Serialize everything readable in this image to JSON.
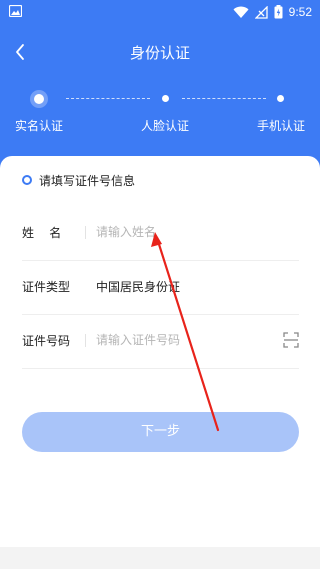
{
  "status_bar": {
    "time": "9:52",
    "icons": [
      "image-icon",
      "wifi-icon",
      "signal-off-icon",
      "battery-charging-icon"
    ]
  },
  "header": {
    "title": "身份认证",
    "back_icon": "chevron-left-icon"
  },
  "stepper": {
    "steps": [
      {
        "label": "实名认证",
        "state": "active"
      },
      {
        "label": "人脸认证",
        "state": "pending"
      },
      {
        "label": "手机认证",
        "state": "pending"
      }
    ]
  },
  "form": {
    "section_title": "请填写证件号信息",
    "name": {
      "label": "姓    名",
      "placeholder": "请输入姓名",
      "value": ""
    },
    "id_type": {
      "label": "证件类型",
      "value": "中国居民身份证"
    },
    "id_number": {
      "label": "证件号码",
      "placeholder": "请输入证件号码",
      "value": "",
      "scan_icon": "scan-icon"
    },
    "next_label": "下一步"
  },
  "colors": {
    "primary": "#3d7bf4",
    "button_disabled": "#a9c4f9",
    "annotation_arrow": "#e8231b"
  }
}
